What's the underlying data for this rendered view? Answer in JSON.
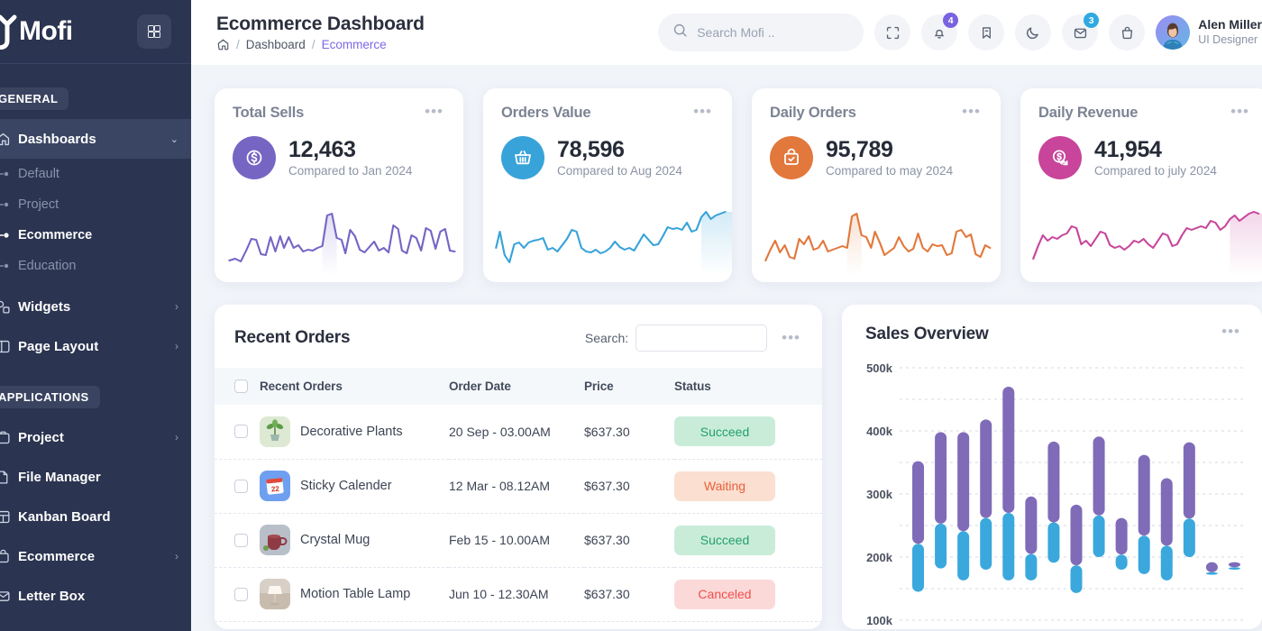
{
  "brand": {
    "name": "Mofi",
    "grid_button": "apps-grid"
  },
  "sidebar": {
    "sections": [
      {
        "label": "GENERAL",
        "items": [
          {
            "label": "Dashboards",
            "icon": "home-icon",
            "active": true,
            "expanded": true,
            "chevron": "⌄",
            "children": [
              {
                "label": "Default",
                "current": false
              },
              {
                "label": "Project",
                "current": false
              },
              {
                "label": "Ecommerce",
                "current": true
              },
              {
                "label": "Education",
                "current": false
              }
            ]
          },
          {
            "label": "Widgets",
            "icon": "widgets-icon",
            "chevron": "›"
          },
          {
            "label": "Page Layout",
            "icon": "layout-icon",
            "chevron": "›"
          }
        ]
      },
      {
        "label": "APPLICATIONS",
        "items": [
          {
            "label": "Project",
            "icon": "project-icon",
            "chevron": "›"
          },
          {
            "label": "File Manager",
            "icon": "file-icon",
            "chevron": ""
          },
          {
            "label": "Kanban Board",
            "icon": "kanban-icon",
            "chevron": ""
          },
          {
            "label": "Ecommerce",
            "icon": "cart-icon",
            "chevron": "›"
          },
          {
            "label": "Letter Box",
            "icon": "mail-icon",
            "chevron": ""
          }
        ]
      }
    ]
  },
  "header": {
    "title": "Ecommerce Dashboard",
    "breadcrumb": {
      "home_icon": "home-icon",
      "items": [
        "Dashboard",
        "Ecommerce"
      ],
      "separator": "/"
    },
    "search": {
      "placeholder": "Search Mofi ..",
      "value": "",
      "icon": "search-icon"
    },
    "icons": [
      {
        "name": "fullscreen-icon",
        "badge": null
      },
      {
        "name": "bell-icon",
        "badge": "4",
        "badge_color": "#7a63e0"
      },
      {
        "name": "bookmark-icon",
        "badge": null
      },
      {
        "name": "moon-icon",
        "badge": null
      },
      {
        "name": "message-icon",
        "badge": "3",
        "badge_color": "#2eaae0"
      },
      {
        "name": "bag-icon",
        "badge": null
      }
    ],
    "user": {
      "name": "Alen Miller",
      "role": "UI Designer",
      "avatar": "user-avatar"
    }
  },
  "stat_cards": [
    {
      "title": "Total Sells",
      "value": "12,463",
      "subtitle": "Compared to Jan 2024",
      "icon": "dollar-coin-icon",
      "color": "#7765c4",
      "menu": "•••"
    },
    {
      "title": "Orders Value",
      "value": "78,596",
      "subtitle": "Compared to Aug 2024",
      "icon": "basket-icon",
      "color": "#37a3d9",
      "menu": "•••"
    },
    {
      "title": "Daily Orders",
      "value": "95,789",
      "subtitle": "Compared to may 2024",
      "icon": "bag-check-icon",
      "color": "#e2783c",
      "menu": "•••"
    },
    {
      "title": "Daily Revenue",
      "value": "41,954",
      "subtitle": "Compared to july 2024",
      "icon": "revenue-arrow-icon",
      "color": "#c8459b",
      "menu": "•••"
    }
  ],
  "orders": {
    "title": "Recent Orders",
    "search_label": "Search:",
    "search_value": "",
    "menu": "•••",
    "columns": [
      "",
      "Recent Orders",
      "Order Date",
      "Price",
      "Status"
    ],
    "rows": [
      {
        "name": "Decorative Plants",
        "date": "20 Sep - 03.00AM",
        "price": "$637.30",
        "status": "Succeed",
        "status_kind": "succeed",
        "thumb": "plant-thumb"
      },
      {
        "name": "Sticky Calender",
        "date": "12 Mar - 08.12AM",
        "price": "$637.30",
        "status": "Waiting",
        "status_kind": "waiting",
        "thumb": "calendar-thumb"
      },
      {
        "name": "Crystal Mug",
        "date": "Feb 15 - 10.00AM",
        "price": "$637.30",
        "status": "Succeed",
        "status_kind": "succeed",
        "thumb": "mug-thumb"
      },
      {
        "name": "Motion Table Lamp",
        "date": "Jun 10 - 12.30AM",
        "price": "$637.30",
        "status": "Canceled",
        "status_kind": "canceled",
        "thumb": "lamp-thumb"
      }
    ]
  },
  "sales": {
    "title": "Sales Overview",
    "menu": "•••"
  },
  "chart_data": {
    "type": "bar",
    "title": "Sales Overview",
    "subtype": "floating-stacked-range-bars",
    "xlabel": "",
    "ylabel": "",
    "ylim": [
      100000,
      500000
    ],
    "ytick_labels": [
      "500k",
      "400k",
      "300k",
      "200k",
      "100k"
    ],
    "ytick_values": [
      500000,
      400000,
      300000,
      200000,
      100000
    ],
    "gridlines": {
      "on": true,
      "style": "dashed",
      "interval": 50000
    },
    "legend": {
      "show": false,
      "position": "none"
    },
    "series": [
      {
        "name": "lower-segment",
        "color": "#3aa8dd"
      },
      {
        "name": "upper-segment",
        "color": "#7f6bb8"
      }
    ],
    "bars": [
      {
        "index": 1,
        "bottom": 145000,
        "split": 221000,
        "top": 352000
      },
      {
        "index": 2,
        "bottom": 182000,
        "split": 253000,
        "top": 398000
      },
      {
        "index": 3,
        "bottom": 163000,
        "split": 241000,
        "top": 398000
      },
      {
        "index": 4,
        "bottom": 180000,
        "split": 262000,
        "top": 418000
      },
      {
        "index": 5,
        "bottom": 163000,
        "split": 270000,
        "top": 470000
      },
      {
        "index": 6,
        "bottom": 163000,
        "split": 205000,
        "top": 296000
      },
      {
        "index": 7,
        "bottom": 191000,
        "split": 255000,
        "top": 383000
      },
      {
        "index": 8,
        "bottom": 143000,
        "split": 187000,
        "top": 283000
      },
      {
        "index": 9,
        "bottom": 200000,
        "split": 266000,
        "top": 391000
      },
      {
        "index": 10,
        "bottom": 180000,
        "split": 204000,
        "top": 262000
      },
      {
        "index": 11,
        "bottom": 173000,
        "split": 234000,
        "top": 362000
      },
      {
        "index": 12,
        "bottom": 163000,
        "split": 218000,
        "top": 325000
      },
      {
        "index": 13,
        "bottom": 200000,
        "split": 261000,
        "top": 382000
      },
      {
        "index": 14,
        "bottom": 172000,
        "split": 176000,
        "top": 192000
      },
      {
        "index": 15,
        "bottom": 180000,
        "split": 184000,
        "top": 192000
      }
    ]
  }
}
